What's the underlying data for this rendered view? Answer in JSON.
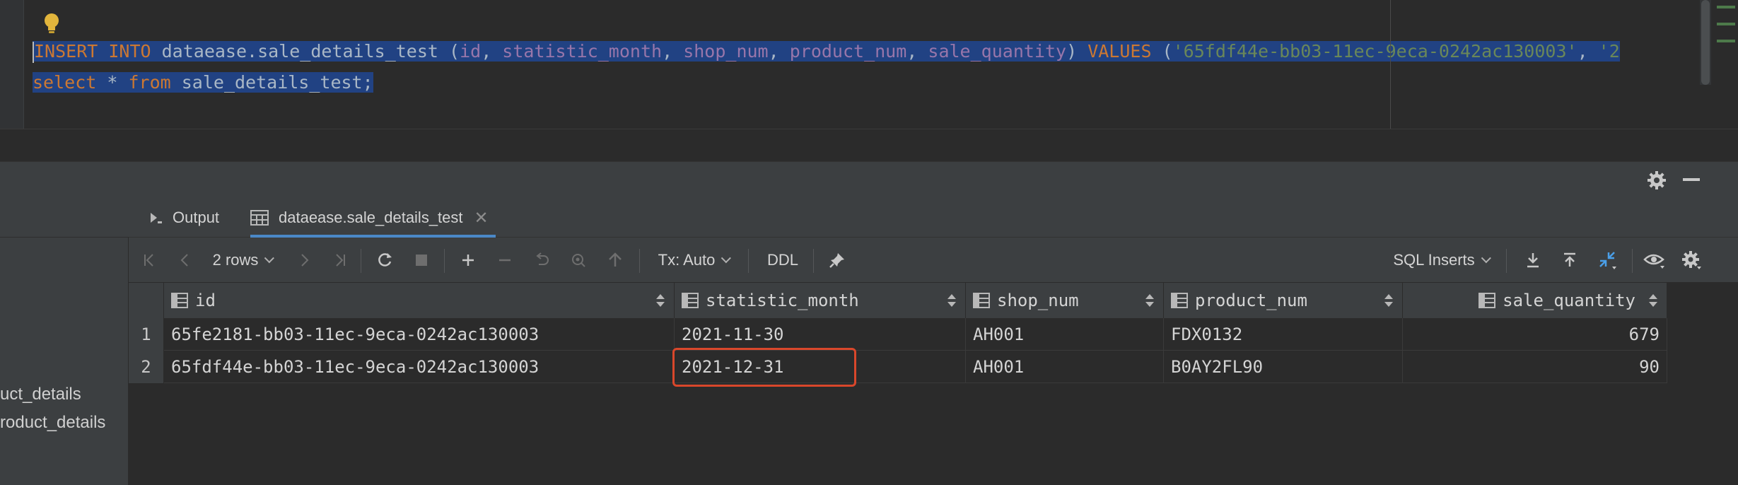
{
  "editor": {
    "line1": [
      {
        "t": "INSERT INTO",
        "c": "kw"
      },
      {
        "t": " dataease.sale_details_test (",
        "c": "id"
      },
      {
        "t": "id",
        "c": "col"
      },
      {
        "t": ", ",
        "c": "id"
      },
      {
        "t": "statistic_month",
        "c": "col"
      },
      {
        "t": ", ",
        "c": "id"
      },
      {
        "t": "shop_num",
        "c": "col"
      },
      {
        "t": ", ",
        "c": "id"
      },
      {
        "t": "product_num",
        "c": "col"
      },
      {
        "t": ", ",
        "c": "id"
      },
      {
        "t": "sale_quantity",
        "c": "col"
      },
      {
        "t": ") ",
        "c": "id"
      },
      {
        "t": "VALUES",
        "c": "kw"
      },
      {
        "t": " (",
        "c": "id"
      },
      {
        "t": "'65fdf44e-bb03-11ec-9eca-0242ac130003'",
        "c": "str"
      },
      {
        "t": ", ",
        "c": "id"
      },
      {
        "t": "'2",
        "c": "str"
      }
    ],
    "line2": [
      {
        "t": "select",
        "c": "kw"
      },
      {
        "t": " * ",
        "c": "id"
      },
      {
        "t": "from",
        "c": "kw"
      },
      {
        "t": " sale_details_test;",
        "c": "id"
      }
    ],
    "line1_first_char": "I"
  },
  "left_panel": {
    "items": [
      "uct_details",
      "roduct_details"
    ]
  },
  "tabs": {
    "output_label": "Output",
    "result_label": "dataease.sale_details_test"
  },
  "toolbar": {
    "rows_label": "2 rows",
    "tx_label": "Tx: Auto",
    "ddl_label": "DDL",
    "export_format": "SQL Inserts"
  },
  "grid": {
    "columns": [
      "id",
      "statistic_month",
      "shop_num",
      "product_num",
      "sale_quantity"
    ],
    "rows": [
      {
        "num": "1",
        "id": "65fe2181-bb03-11ec-9eca-0242ac130003",
        "statistic_month": "2021-11-30",
        "shop_num": "AH001",
        "product_num": "FDX0132",
        "sale_quantity": "679"
      },
      {
        "num": "2",
        "id": "65fdf44e-bb03-11ec-9eca-0242ac130003",
        "statistic_month": "2021-12-31",
        "shop_num": "AH001",
        "product_num": "B0AY2FL90",
        "sale_quantity": "90"
      }
    ]
  },
  "colors": {
    "keyword": "#cc7832",
    "column": "#9876aa",
    "string": "#6a8759",
    "selection": "#214283",
    "highlight_box": "#d9472b",
    "tab_underline": "#4a88c7"
  }
}
